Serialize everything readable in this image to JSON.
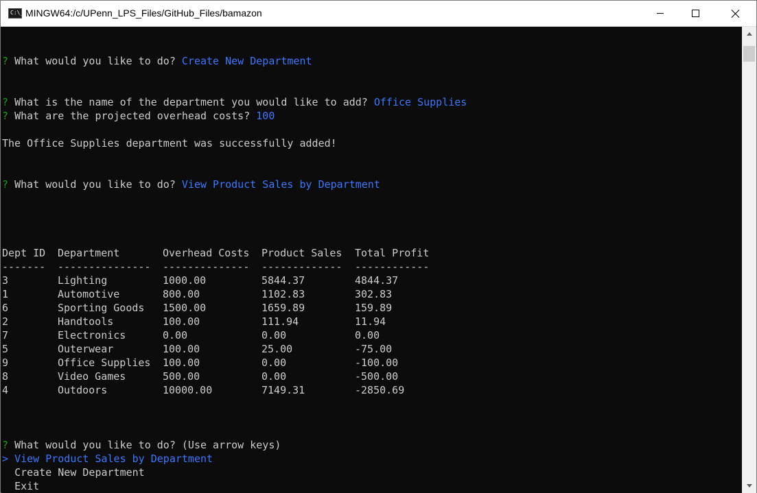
{
  "window": {
    "title": "MINGW64:/c/UPenn_LPS_Files/GitHub_Files/bamazon",
    "icon_label": "C:\\_"
  },
  "terminal": {
    "prompt_mark": "?",
    "block1": {
      "question": "What would you like to do?",
      "answer": "Create New Department"
    },
    "block2": {
      "question": "What is the name of the department you would like to add?",
      "answer": "Office Supplies"
    },
    "block3": {
      "question": "What are the projected overhead costs?",
      "answer": "100"
    },
    "success_message": "The Office Supplies department was successfully added!",
    "block4": {
      "question": "What would you like to do?",
      "answer": "View Product Sales by Department"
    },
    "table": {
      "headers": [
        "Dept ID",
        "Department",
        "Overhead Costs",
        "Product Sales",
        "Total Profit"
      ],
      "dividers": [
        "-------",
        "---------------",
        "--------------",
        "-------------",
        "------------"
      ],
      "rows": [
        [
          "3",
          "Lighting",
          "1000.00",
          "5844.37",
          "4844.37"
        ],
        [
          "1",
          "Automotive",
          "800.00",
          "1102.83",
          "302.83"
        ],
        [
          "6",
          "Sporting Goods",
          "1500.00",
          "1659.89",
          "159.89"
        ],
        [
          "2",
          "Handtools",
          "100.00",
          "111.94",
          "11.94"
        ],
        [
          "7",
          "Electronics",
          "0.00",
          "0.00",
          "0.00"
        ],
        [
          "5",
          "Outerwear",
          "100.00",
          "25.00",
          "-75.00"
        ],
        [
          "9",
          "Office Supplies",
          "100.00",
          "0.00",
          "-100.00"
        ],
        [
          "8",
          "Video Games",
          "500.00",
          "0.00",
          "-500.00"
        ],
        [
          "4",
          "Outdoors",
          "10000.00",
          "7149.31",
          "-2850.69"
        ]
      ]
    },
    "block5": {
      "question": "What would you like to do?",
      "hint": "(Use arrow keys)"
    },
    "menu": {
      "pointer": ">",
      "items": [
        "View Product Sales by Department",
        "Create New Department",
        "Exit"
      ]
    }
  },
  "colors": {
    "background": "#0c0c0c",
    "text": "#cccccc",
    "prompt_green": "#13a10e",
    "answer_blue": "#3b78ff"
  },
  "icons": [
    "terminal-app-icon",
    "minimize-icon",
    "maximize-icon",
    "close-icon",
    "scroll-up-arrow-icon",
    "scroll-down-arrow-icon"
  ]
}
